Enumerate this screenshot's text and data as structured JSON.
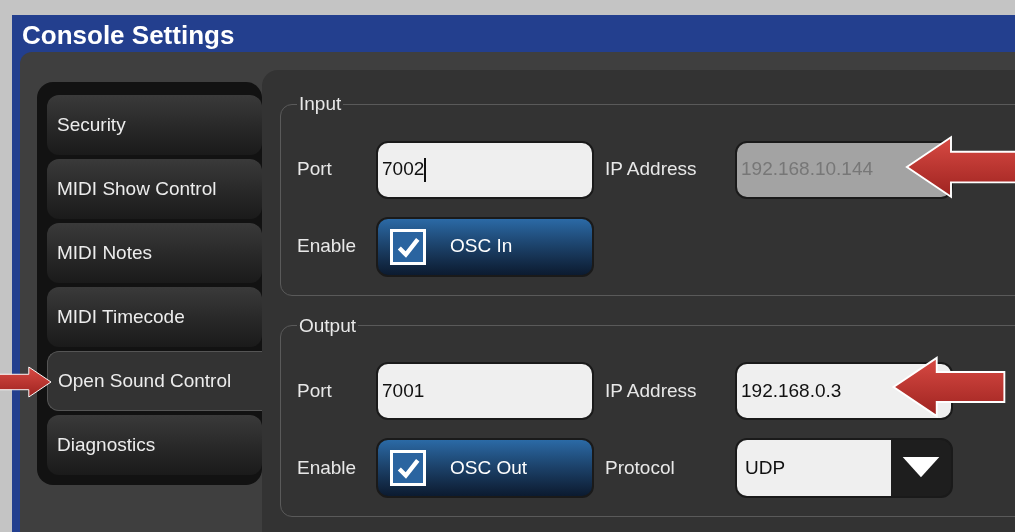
{
  "window": {
    "title": "Console Settings"
  },
  "sidebar": {
    "items": [
      {
        "label": "Security",
        "selected": false
      },
      {
        "label": "MIDI Show Control",
        "selected": false
      },
      {
        "label": "MIDI Notes",
        "selected": false
      },
      {
        "label": "MIDI Timecode",
        "selected": false
      },
      {
        "label": "Open Sound Control",
        "selected": true
      },
      {
        "label": "Diagnostics",
        "selected": false
      }
    ]
  },
  "sections": [
    {
      "title": "Input",
      "fields": [
        {
          "kind": "text",
          "label": "Port",
          "value": "7002",
          "focused": true,
          "disabled": false
        },
        {
          "kind": "text",
          "label": "IP Address",
          "value": "192.168.10.144",
          "focused": false,
          "disabled": true
        },
        {
          "kind": "toggle",
          "label": "Enable",
          "text": "OSC In",
          "checked": true
        }
      ]
    },
    {
      "title": "Output",
      "fields": [
        {
          "kind": "text",
          "label": "Port",
          "value": "7001",
          "focused": false,
          "disabled": false
        },
        {
          "kind": "text",
          "label": "IP Address",
          "value": "192.168.0.3",
          "focused": false,
          "disabled": false
        },
        {
          "kind": "toggle",
          "label": "Enable",
          "text": "OSC Out",
          "checked": true
        },
        {
          "kind": "select",
          "label": "Protocol",
          "value": "UDP"
        }
      ]
    }
  ]
}
